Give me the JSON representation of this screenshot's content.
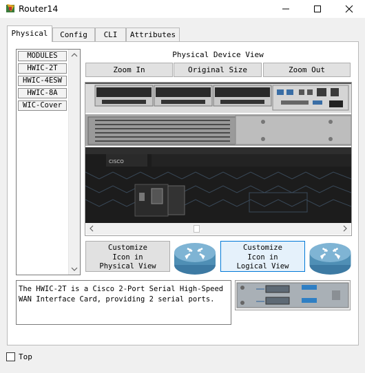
{
  "window": {
    "title": "Router14",
    "controls": [
      "minimize",
      "maximize",
      "close"
    ]
  },
  "tabs": [
    {
      "label": "Physical",
      "active": true
    },
    {
      "label": "Config",
      "active": false
    },
    {
      "label": "CLI",
      "active": false
    },
    {
      "label": "Attributes",
      "active": false
    }
  ],
  "modules": {
    "items": [
      "MODULES",
      "HWIC-2T",
      "HWIC-4ESW",
      "HWIC-8A",
      "WIC-Cover"
    ]
  },
  "physical_view": {
    "title": "Physical Device View",
    "zoom_in": "Zoom In",
    "original_size": "Original Size",
    "zoom_out": "Zoom Out",
    "device_brand": "CISCO"
  },
  "customize": {
    "physical": "Customize\nIcon in\nPhysical View",
    "logical": "Customize\nIcon in\nLogical View"
  },
  "description": "The HWIC-2T is a Cisco 2-Port Serial High-Speed\nWAN Interface Card, providing 2 serial ports.",
  "footer": {
    "top_label": "Top",
    "top_checked": false
  },
  "colors": {
    "router_blue": "#4f8fb5",
    "selected_button": "#e5f1fb",
    "selected_border": "#0078d7"
  }
}
